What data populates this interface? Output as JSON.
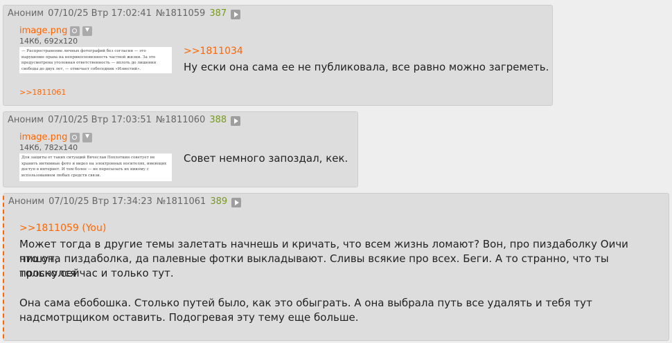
{
  "posts": [
    {
      "author": "Аноним",
      "date": "07/10/25 Втр 17:02:41",
      "number": "№1811059",
      "index": "387",
      "file": {
        "name": "image.png",
        "meta": "14Кб, 692x120",
        "thumb_text": "— Распространение личных фотографий без согласия — это нарушение права на неприкосновенность частной жизни. За это предусмотрена уголовная ответственность — вплоть до лишения свободы до двух лет, — отмечает собеседник «Известий»."
      },
      "reply_ref": ">>1811034",
      "text": "Ну ески она сама ее не публиковала, все равно можно загреметь.",
      "backlink": ">>1811061"
    },
    {
      "author": "Аноним",
      "date": "07/10/25 Втр 17:03:51",
      "number": "№1811060",
      "index": "388",
      "file": {
        "name": "image.png",
        "meta": "14Кб, 782x140",
        "thumb_text": "Для защиты от таких ситуаций Вячеслав Похлоткин советует не хранить интимные фото и видео на электронных носителях, имеющих доступ в интернет. И тем более — не пересылать их никому с использованием любых средств связи."
      },
      "text": "Совет немного запоздал, кек."
    },
    {
      "author": "Аноним",
      "date": "07/10/25 Втр 17:34:23",
      "number": "№1811061",
      "index": "389",
      "reply_ref": ">>1811059 (You)",
      "line1": "Может тогда в другие темы залетать начнешь и кричать, что всем жизнь ломают? Вон, про пиздаболку Оичи пишут,",
      "line2": "что она пиздаболка, да палевные фотки выкладывают. Сливы всякие про всех. Беги. А то странно, что ты проснулся",
      "line3": "только сейчас и только тут.",
      "line4": "Она сама ебобошка. Столько путей было, как это обыграть. А она выбрала путь все удалять и тебя тут",
      "line5": "надсмотрщиком оставить. Подогревая эту тему еще больше."
    }
  ],
  "colors": {
    "accent": "#ff6600",
    "replies": "#789922",
    "post_bg": "#dddddd"
  },
  "icons": [
    "play-icon",
    "search-icon",
    "download-icon"
  ]
}
